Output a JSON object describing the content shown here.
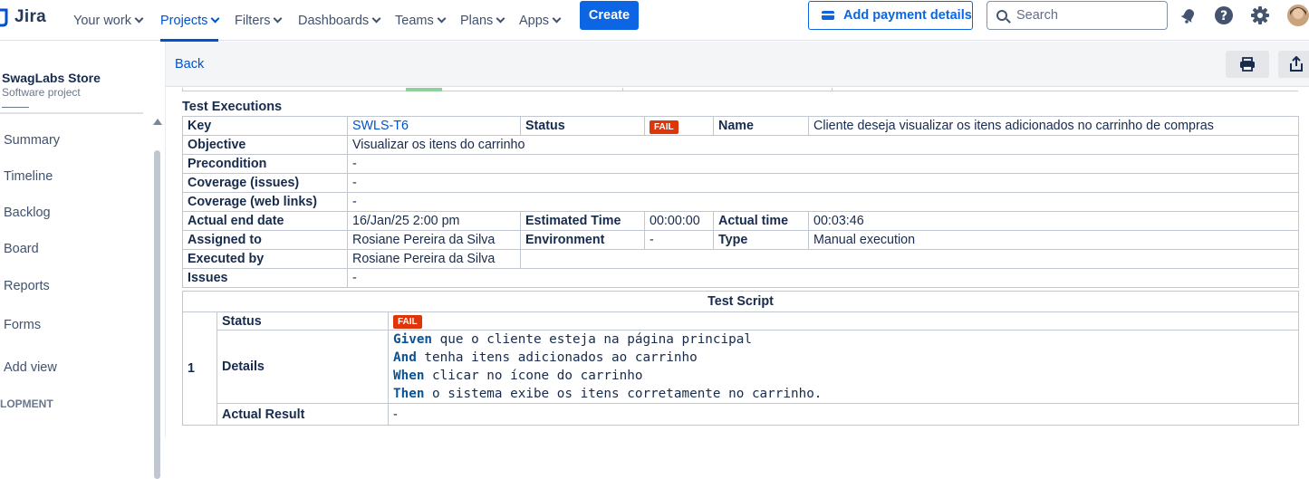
{
  "topnav": {
    "brand": "Jira",
    "items": [
      {
        "label": "Your work",
        "active": false
      },
      {
        "label": "Projects",
        "active": true
      },
      {
        "label": "Filters",
        "active": false
      },
      {
        "label": "Dashboards",
        "active": false
      },
      {
        "label": "Teams",
        "active": false
      },
      {
        "label": "Plans",
        "active": false
      },
      {
        "label": "Apps",
        "active": false
      }
    ],
    "create_label": "Create",
    "payment_label": "Add payment details",
    "search_placeholder": "Search",
    "accent": "#0c66e4"
  },
  "sidebar": {
    "project_name": "SwagLabs Store",
    "project_type": "Software project",
    "items": [
      "Summary",
      "Timeline",
      "Backlog",
      "Board",
      "Reports",
      "Forms",
      "Add view"
    ],
    "section_label": "LOPMENT"
  },
  "subheader": {
    "back_label": "Back"
  },
  "test_executions": {
    "title": "Test Executions",
    "labels": {
      "key": "Key",
      "status": "Status",
      "name": "Name",
      "objective": "Objective",
      "precondition": "Precondition",
      "coverage_issues": "Coverage (issues)",
      "coverage_links": "Coverage (web links)",
      "actual_end_date": "Actual end date",
      "estimated_time": "Estimated Time",
      "actual_time": "Actual time",
      "assigned_to": "Assigned to",
      "environment": "Environment",
      "type": "Type",
      "executed_by": "Executed by",
      "issues": "Issues"
    },
    "values": {
      "key": "SWLS-T6",
      "status": "FAIL",
      "name": "Cliente deseja visualizar os itens adicionados no carrinho de compras",
      "objective": "Visualizar os itens do carrinho",
      "precondition": "-",
      "coverage_issues": "-",
      "coverage_links": "-",
      "actual_end_date": "16/Jan/25 2:00 pm",
      "estimated_time": "00:00:00",
      "actual_time": "00:03:46",
      "assigned_to": "Rosiane Pereira da Silva",
      "environment": "-",
      "type": "Manual execution",
      "executed_by": "Rosiane Pereira da Silva",
      "issues": "-"
    },
    "fail_color": "#de350b"
  },
  "test_script": {
    "title": "Test Script",
    "step_number": "1",
    "labels": {
      "status": "Status",
      "details": "Details",
      "actual_result": "Actual Result"
    },
    "status": "FAIL",
    "details": [
      {
        "keyword": "Given",
        "text": " que o cliente esteja na página principal"
      },
      {
        "keyword": "And",
        "text": " tenha itens adicionados ao carrinho"
      },
      {
        "keyword": "When",
        "text": " clicar no ícone do carrinho"
      },
      {
        "keyword": "Then",
        "text": " o sistema exibe os itens corretamente no carrinho."
      }
    ],
    "actual_result": "-"
  }
}
